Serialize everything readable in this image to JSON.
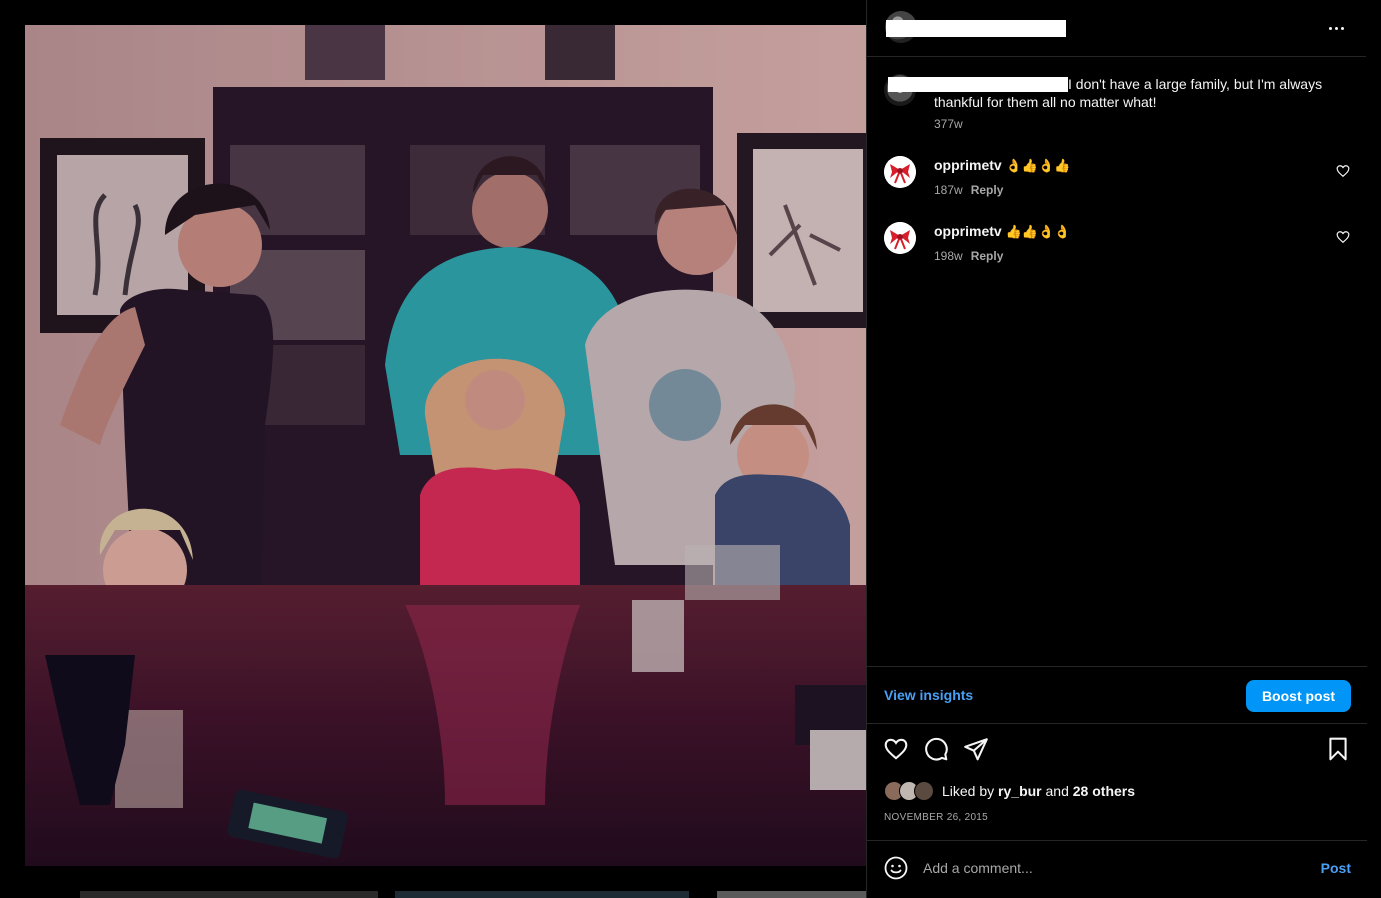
{
  "post": {
    "image_alt": "Family photo around a dining table",
    "more_icon": "more-options-icon"
  },
  "caption": {
    "text": "I don't have a large family, but I'm always thankful for them all no matter what!",
    "time": "377w"
  },
  "comments": [
    {
      "username": "opprimetv",
      "emoji": "👌👍👌👍",
      "time": "187w",
      "reply_label": "Reply"
    },
    {
      "username": "opprimetv",
      "emoji": "👍👍👌👌",
      "time": "198w",
      "reply_label": "Reply"
    }
  ],
  "insights": {
    "view_label": "View insights",
    "boost_label": "Boost post"
  },
  "actions": {
    "icons": [
      "heart-icon",
      "comment-icon",
      "share-icon",
      "bookmark-icon"
    ]
  },
  "likes": {
    "prefix": "Liked by",
    "user": "ry_bur",
    "joiner": "and",
    "others": "28 others"
  },
  "date": "NOVEMBER 26, 2015",
  "comment_box": {
    "placeholder": "Add a comment...",
    "post_label": "Post"
  },
  "colors": {
    "accent": "#0095f6",
    "link": "#4a9ff5",
    "muted": "#a8a8a8",
    "divider": "#262626"
  }
}
